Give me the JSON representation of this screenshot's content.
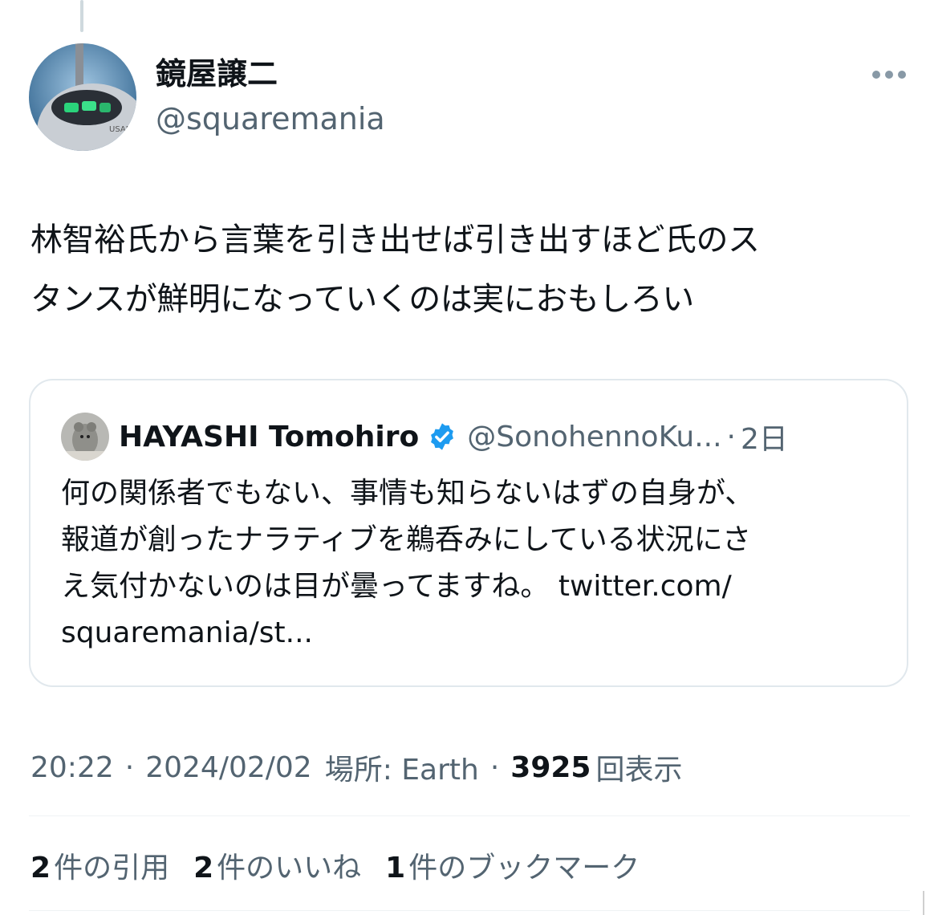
{
  "tweet": {
    "author": {
      "display_name": "鏡屋譲二",
      "handle": "@squaremania",
      "avatar_icon": "aircraft-cockpit-avatar"
    },
    "text": "林智裕氏から言葉を引き出せば引き出すほど氏のス\nタンスが鮮明になっていくのは実におもしろい",
    "more_icon": "more-dots-icon",
    "quote": {
      "author_name": "HAYASHI Tomohiro",
      "handle": "@SonohennoKu...",
      "dot": "·",
      "time": "2日",
      "verified_icon": "verified-badge-icon",
      "text": "何の関係者でもない、事情も知らないはずの自身が、\n報道が創ったナラティブを鵜呑みにしている状況にさ\nえ気付かないのは目が曇ってますね。 twitter.com/\nsquaremania/st..."
    },
    "meta": {
      "time": "20:22",
      "date": "2024/02/02",
      "location": "場所: Earth",
      "views_count": "3925",
      "views_label": "回表示",
      "sep": "·"
    },
    "stats": [
      {
        "count": "2",
        "label": "件の引用"
      },
      {
        "count": "2",
        "label": "件のいいね"
      },
      {
        "count": "1",
        "label": "件のブックマーク"
      }
    ]
  },
  "colors": {
    "text_primary": "#0f1419",
    "text_secondary": "#536471",
    "border": "#e1e8ed",
    "verified_blue": "#1d9bf0"
  }
}
